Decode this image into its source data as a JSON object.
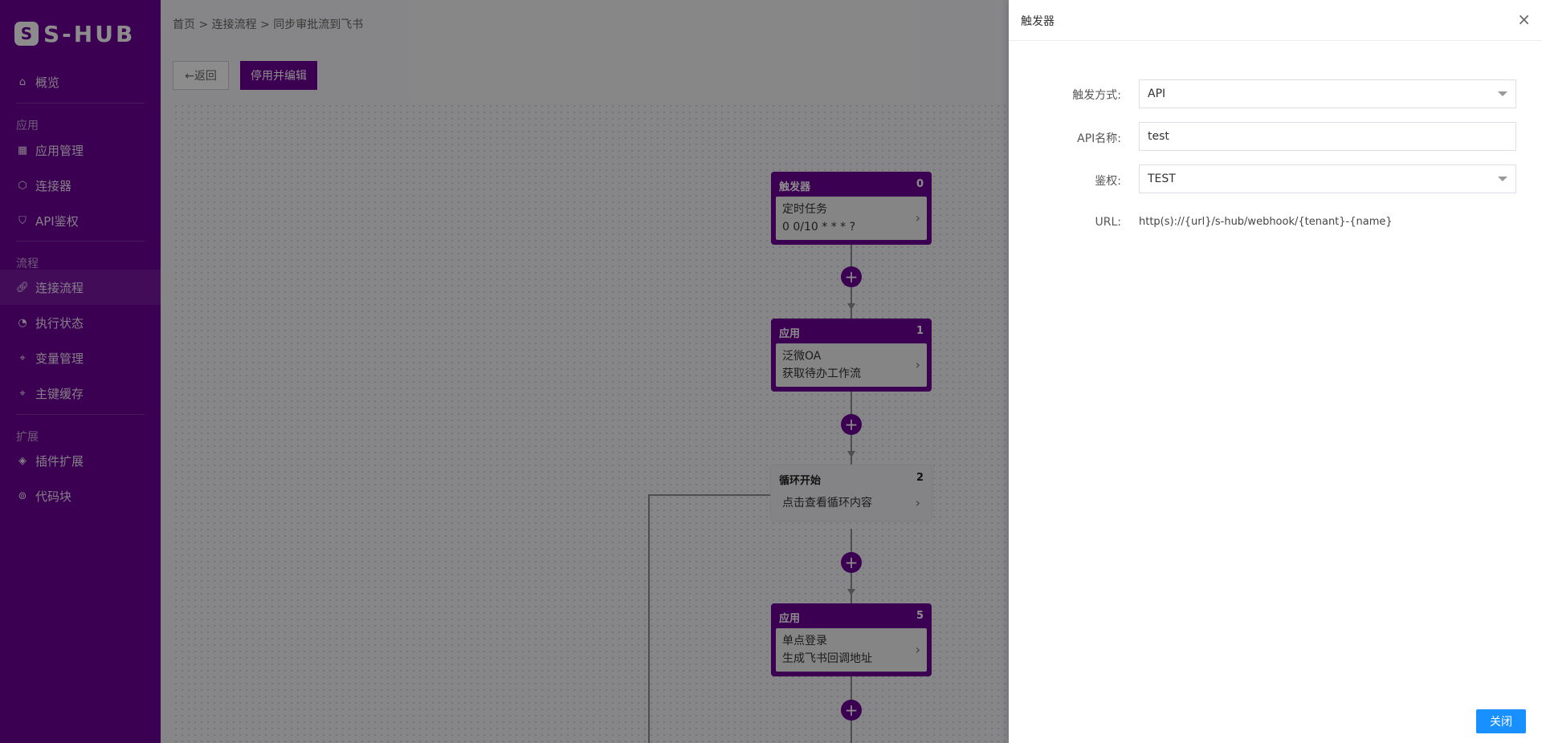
{
  "brand": {
    "mark": "S",
    "name": "S-HUB"
  },
  "sidebar": {
    "items": [
      {
        "label": "概览",
        "icon": "home-icon"
      },
      {
        "group": "应用"
      },
      {
        "label": "应用管理",
        "icon": "apps-icon"
      },
      {
        "label": "连接器",
        "icon": "cube-icon"
      },
      {
        "label": "API鉴权",
        "icon": "shield-icon"
      },
      {
        "group": "流程"
      },
      {
        "label": "连接流程",
        "icon": "link-icon",
        "active": true
      },
      {
        "label": "执行状态",
        "icon": "status-icon"
      },
      {
        "label": "变量管理",
        "icon": "tag-icon"
      },
      {
        "label": "主键缓存",
        "icon": "tag-icon"
      },
      {
        "group": "扩展"
      },
      {
        "label": "插件扩展",
        "icon": "layers-icon"
      },
      {
        "label": "代码块",
        "icon": "code-icon"
      }
    ]
  },
  "breadcrumb": {
    "home": "首页",
    "sep1": " > ",
    "flows": "连接流程",
    "sep2": " > ",
    "current": "同步审批流到飞书"
  },
  "toolbar": {
    "back": "←返回",
    "stop_edit": "停用并编辑"
  },
  "flow": {
    "nodes": [
      {
        "title": "触发器",
        "index": "0",
        "line1": "定时任务",
        "line2": "0 0/10 * * * ?"
      },
      {
        "title": "应用",
        "index": "1",
        "line1": "泛微OA",
        "line2": "获取待办工作流"
      },
      {
        "title": "循环开始",
        "index": "2",
        "line1": "点击查看循环内容"
      },
      {
        "title": "应用",
        "index": "5",
        "line1": "单点登录",
        "line2": "生成飞书回调地址"
      }
    ],
    "plus": "+"
  },
  "drawer": {
    "title": "触发器",
    "close_icon": "×",
    "fields": {
      "trigger_label": "触发方式:",
      "trigger_value": "API",
      "api_name_label": "API名称:",
      "api_name_value": "test",
      "auth_label": "鉴权:",
      "auth_value": "TEST",
      "url_label": "URL:",
      "url_value": "http(s)://{url}/s-hub/webhook/{tenant}-{name}"
    },
    "close_button": "关闭"
  }
}
